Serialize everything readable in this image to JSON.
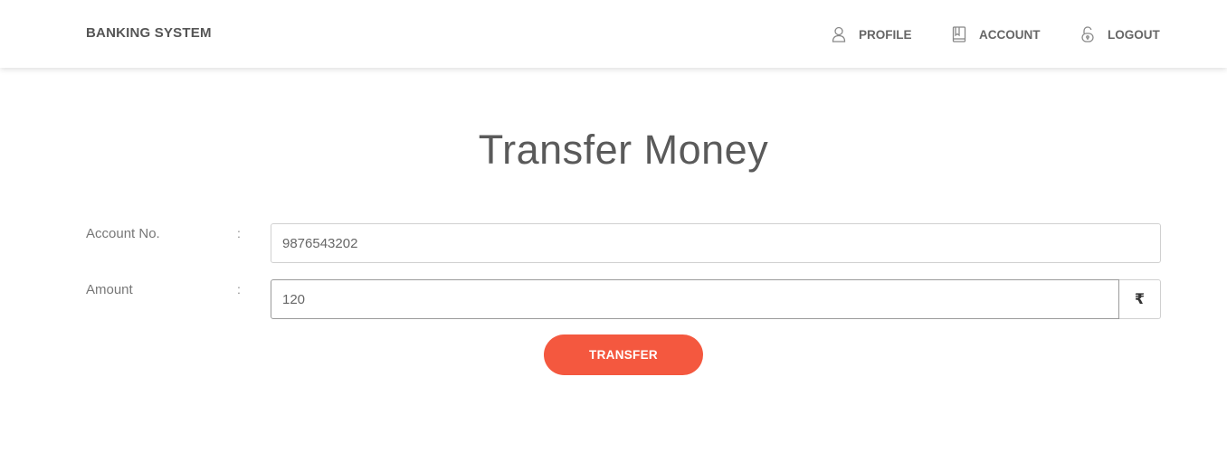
{
  "navbar": {
    "brand": "BANKING SYSTEM",
    "items": [
      {
        "label": "PROFILE",
        "icon": "user-icon"
      },
      {
        "label": "ACCOUNT",
        "icon": "book-icon"
      },
      {
        "label": "LOGOUT",
        "icon": "lock-icon"
      }
    ]
  },
  "main": {
    "title": "Transfer Money",
    "form": {
      "account_label": "Account No.",
      "account_value": "9876543202",
      "amount_label": "Amount",
      "amount_value": "120",
      "separator": ":",
      "currency_symbol": "₹"
    },
    "submit_label": "TRANSFER"
  },
  "colors": {
    "accent": "#f4583f",
    "text": "#555555"
  }
}
